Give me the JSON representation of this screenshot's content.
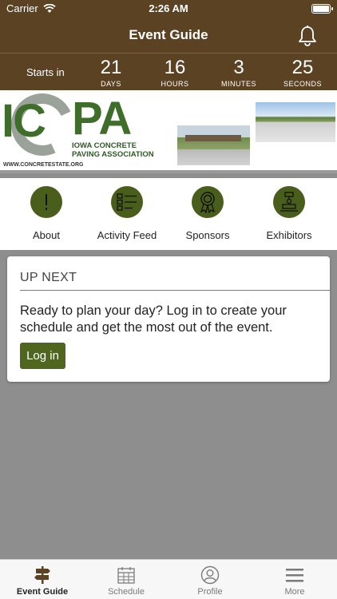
{
  "status_bar": {
    "carrier": "Carrier",
    "time": "2:26 AM"
  },
  "header": {
    "title": "Event Guide"
  },
  "countdown": {
    "label": "Starts in",
    "units": [
      {
        "value": "21",
        "label": "DAYS"
      },
      {
        "value": "16",
        "label": "HOURS"
      },
      {
        "value": "3",
        "label": "MINUTES"
      },
      {
        "value": "25",
        "label": "SECONDS"
      }
    ]
  },
  "banner": {
    "logo_text_left": "IC",
    "logo_text_right": "PA",
    "org_line1": "IOWA CONCRETE",
    "org_line2": "PAVING ASSOCIATION",
    "url": "WWW.CONCRETESTATE.ORG"
  },
  "quick_links": [
    {
      "label": "About",
      "icon": "exclamation-icon"
    },
    {
      "label": "Activity Feed",
      "icon": "list-icon"
    },
    {
      "label": "Sponsors",
      "icon": "ribbon-icon"
    },
    {
      "label": "Exhibitors",
      "icon": "booth-icon"
    }
  ],
  "up_next": {
    "heading": "UP NEXT",
    "message": "Ready to plan your day? Log in to create your schedule and get the most out of the event.",
    "login_label": "Log in"
  },
  "tab_bar": [
    {
      "label": "Event Guide",
      "icon": "signpost-icon",
      "active": true
    },
    {
      "label": "Schedule",
      "icon": "calendar-icon",
      "active": false
    },
    {
      "label": "Profile",
      "icon": "profile-icon",
      "active": false
    },
    {
      "label": "More",
      "icon": "menu-icon",
      "active": false
    }
  ],
  "colors": {
    "header_brown": "#5a4223",
    "accent_green": "#4a5e1c",
    "button_green": "#4f661f",
    "background_gray": "#8e8e8e"
  }
}
